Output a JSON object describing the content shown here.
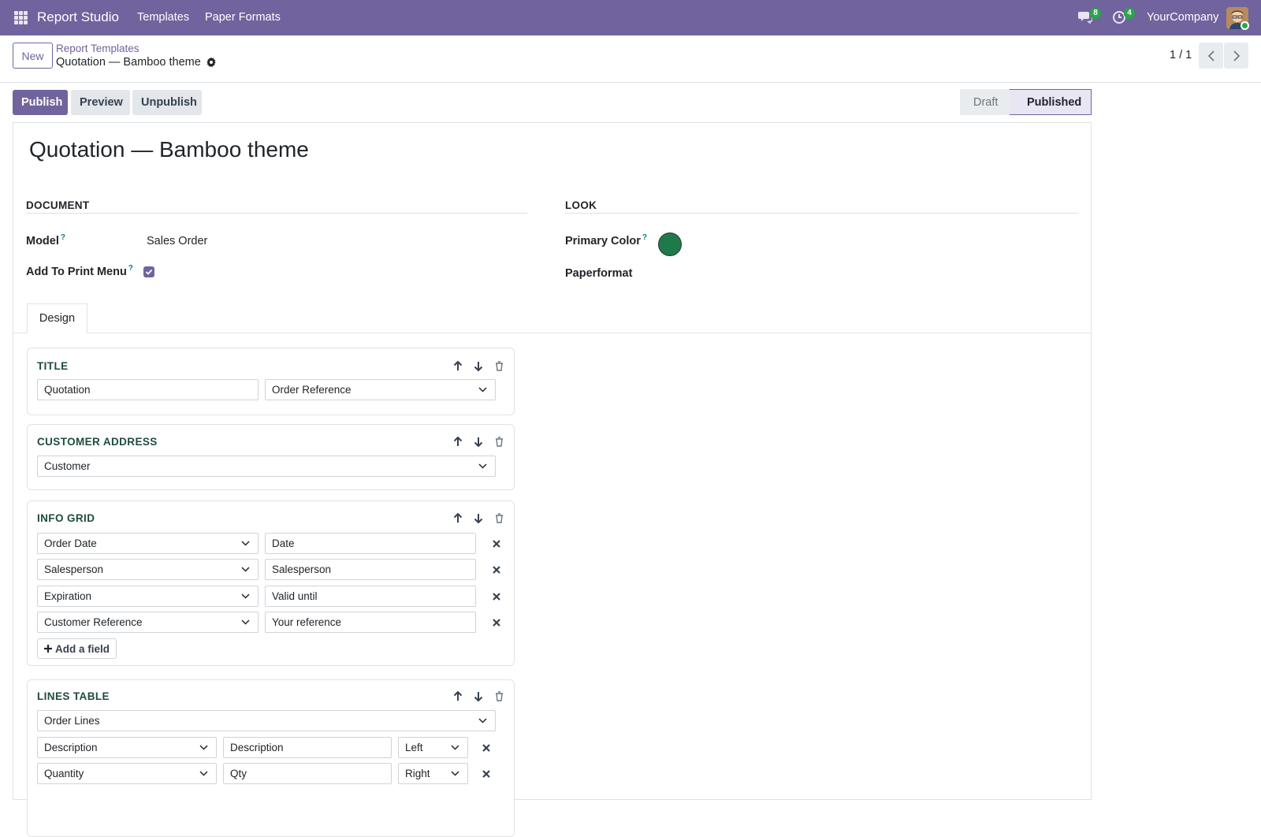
{
  "navbar": {
    "app_name": "Report Studio",
    "menu": [
      "Templates",
      "Paper Formats"
    ],
    "messages_count": "8",
    "activities_count": "4",
    "company": "YourCompany"
  },
  "control_panel": {
    "new_label": "New",
    "breadcrumb_parent": "Report Templates",
    "breadcrumb_current": "Quotation — Bamboo theme",
    "pager": "1 / 1"
  },
  "statusbar": {
    "buttons": [
      "Publish",
      "Preview",
      "Unpublish"
    ],
    "stages": [
      "Draft",
      "Published"
    ],
    "active_stage": "Published"
  },
  "form": {
    "title": "Quotation — Bamboo theme",
    "document_group": "DOCUMENT",
    "look_group": "LOOK",
    "model_label": "Model",
    "model_value": "Sales Order",
    "print_menu_label": "Add To Print Menu",
    "print_menu_checked": true,
    "primary_color_label": "Primary Color",
    "primary_color": "#1e7a4a",
    "paperformat_label": "Paperformat",
    "help_mark": "?",
    "tab": "Design"
  },
  "blocks": {
    "title": {
      "heading": "TITLE",
      "text_value": "Quotation",
      "field_value": "Order Reference"
    },
    "customer_address": {
      "heading": "CUSTOMER ADDRESS",
      "field_value": "Customer"
    },
    "info_grid": {
      "heading": "INFO GRID",
      "rows": [
        {
          "field": "Order Date",
          "label": "Date"
        },
        {
          "field": "Salesperson",
          "label": "Salesperson"
        },
        {
          "field": "Expiration",
          "label": "Valid until"
        },
        {
          "field": "Customer Reference",
          "label": "Your reference"
        }
      ],
      "add_label": "Add a field"
    },
    "lines_table": {
      "heading": "LINES TABLE",
      "source": "Order Lines",
      "columns": [
        {
          "field": "Description",
          "label": "Description",
          "align": "Left"
        },
        {
          "field": "Quantity",
          "label": "Qty",
          "align": "Right"
        }
      ]
    }
  },
  "colors": {
    "brand": "#71639e",
    "block_heading": "#1e4d3a",
    "badge": "#28a745"
  }
}
